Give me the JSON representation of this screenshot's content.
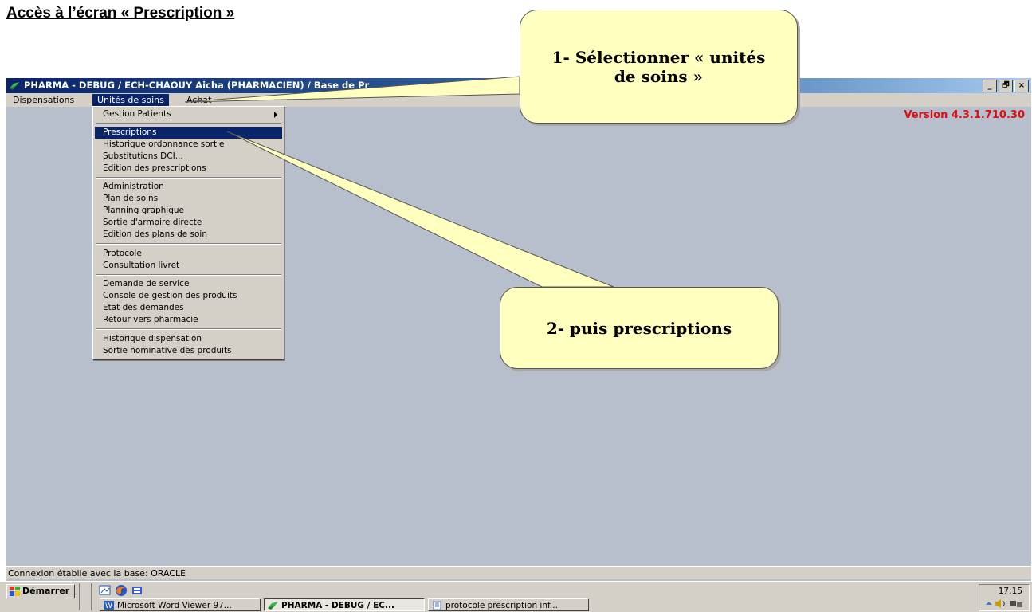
{
  "document": {
    "heading": "Accès à l’écran « Prescription »"
  },
  "window": {
    "title": "PHARMA - DEBUG / ECH-CHAOUY Aicha (PHARMACIEN) / Base de Pr",
    "controls": [
      "_",
      "🗗",
      "×"
    ],
    "version": "Version 4.3.1.710.30"
  },
  "menubar": {
    "items": [
      "Dispensations",
      "Unités de soins",
      "Achat"
    ]
  },
  "dropdown": {
    "items": [
      "Gestion Patients",
      "Prescriptions",
      "Historique ordonnance sortie",
      "Substitutions DCI...",
      "Edition des prescriptions",
      "Administration",
      "Plan de soins",
      "Planning graphique",
      "Sortie d'armoire directe",
      "Edition des plans de soin",
      "Protocole",
      "Consultation livret",
      "Demande de service",
      "Console de gestion des produits",
      "Etat des demandes",
      "Retour vers pharmacie",
      "Historique dispensation",
      "Sortie nominative des produits"
    ]
  },
  "statusbar": {
    "text": "Connexion établie avec la base: ORACLE"
  },
  "taskbar": {
    "start_label": "Démarrer",
    "tasks": [
      "Microsoft Word Viewer 97...",
      "PHARMA - DEBUG / EC...",
      "protocole prescription inf..."
    ],
    "clock": "17:15"
  },
  "callouts": {
    "step1_line1": "1- Sélectionner « unités",
    "step1_line2": "de soins »",
    "step2": "2- puis prescriptions"
  },
  "colors": {
    "titlebar": "#0a246a",
    "workspace": "#b8bfcc",
    "version": "#e01010",
    "callout": "#ffffc0",
    "highlight": "#0a246a"
  }
}
